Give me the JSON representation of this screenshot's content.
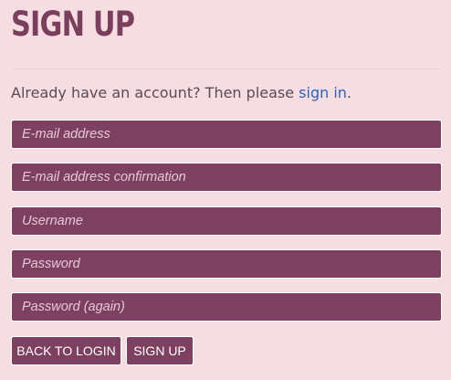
{
  "page": {
    "title": "SIGN UP"
  },
  "intro": {
    "text": "Already have an account? Then please ",
    "link_label": "sign in",
    "suffix": "."
  },
  "form": {
    "email_placeholder": "E-mail address",
    "email_confirm_placeholder": "E-mail address confirmation",
    "username_placeholder": "Username",
    "password_placeholder": "Password",
    "password_again_placeholder": "Password (again)"
  },
  "buttons": {
    "back_to_login": "BACK TO LOGIN",
    "sign_up": "SIGN UP"
  },
  "colors": {
    "background": "#f6dde2",
    "accent": "#7d4060",
    "link": "#2d5fb8"
  }
}
